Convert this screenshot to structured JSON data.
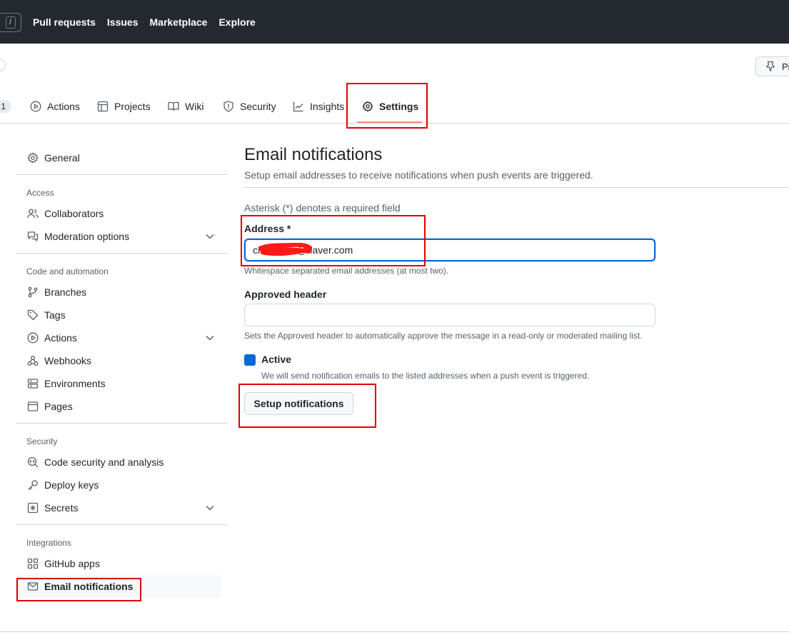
{
  "topnav": {
    "slash": "/",
    "items": [
      "Pull requests",
      "Issues",
      "Marketplace",
      "Explore"
    ]
  },
  "repo_header": {
    "pin_label": "Pi"
  },
  "tabs": {
    "counter": "1",
    "items": [
      {
        "label": "Actions",
        "icon": "play-icon"
      },
      {
        "label": "Projects",
        "icon": "table-icon"
      },
      {
        "label": "Wiki",
        "icon": "book-icon"
      },
      {
        "label": "Security",
        "icon": "shield-icon"
      },
      {
        "label": "Insights",
        "icon": "graph-icon"
      },
      {
        "label": "Settings",
        "icon": "gear-icon",
        "selected": true
      }
    ]
  },
  "sidebar": {
    "general": "General",
    "access_heading": "Access",
    "collaborators": "Collaborators",
    "moderation": "Moderation options",
    "code_heading": "Code and automation",
    "branches": "Branches",
    "tags": "Tags",
    "actions": "Actions",
    "webhooks": "Webhooks",
    "environments": "Environments",
    "pages": "Pages",
    "security_heading": "Security",
    "code_security": "Code security and analysis",
    "deploy_keys": "Deploy keys",
    "secrets": "Secrets",
    "integrations_heading": "Integrations",
    "github_apps": "GitHub apps",
    "email_notifications": "Email notifications"
  },
  "main": {
    "title": "Email notifications",
    "subtitle": "Setup email addresses to receive notifications when push events are triggered.",
    "required_note": "Asterisk (*) denotes a required field",
    "address_label": "Address *",
    "address_value": "ch            @naver.com",
    "address_hint": "Whitespace separated email addresses (at most two).",
    "approved_label": "Approved header",
    "approved_value": "",
    "approved_hint": "Sets the Approved header to automatically approve the message in a read-only or moderated mailing list.",
    "active_label": "Active",
    "active_checked": true,
    "active_hint": "We will send notification emails to the listed addresses when a push event is triggered.",
    "setup_button": "Setup notifications"
  },
  "colors": {
    "accent": "#0969da",
    "annotation": "#e00000",
    "topbar": "#24292f",
    "selected_tab_underline": "#fd8c73"
  }
}
